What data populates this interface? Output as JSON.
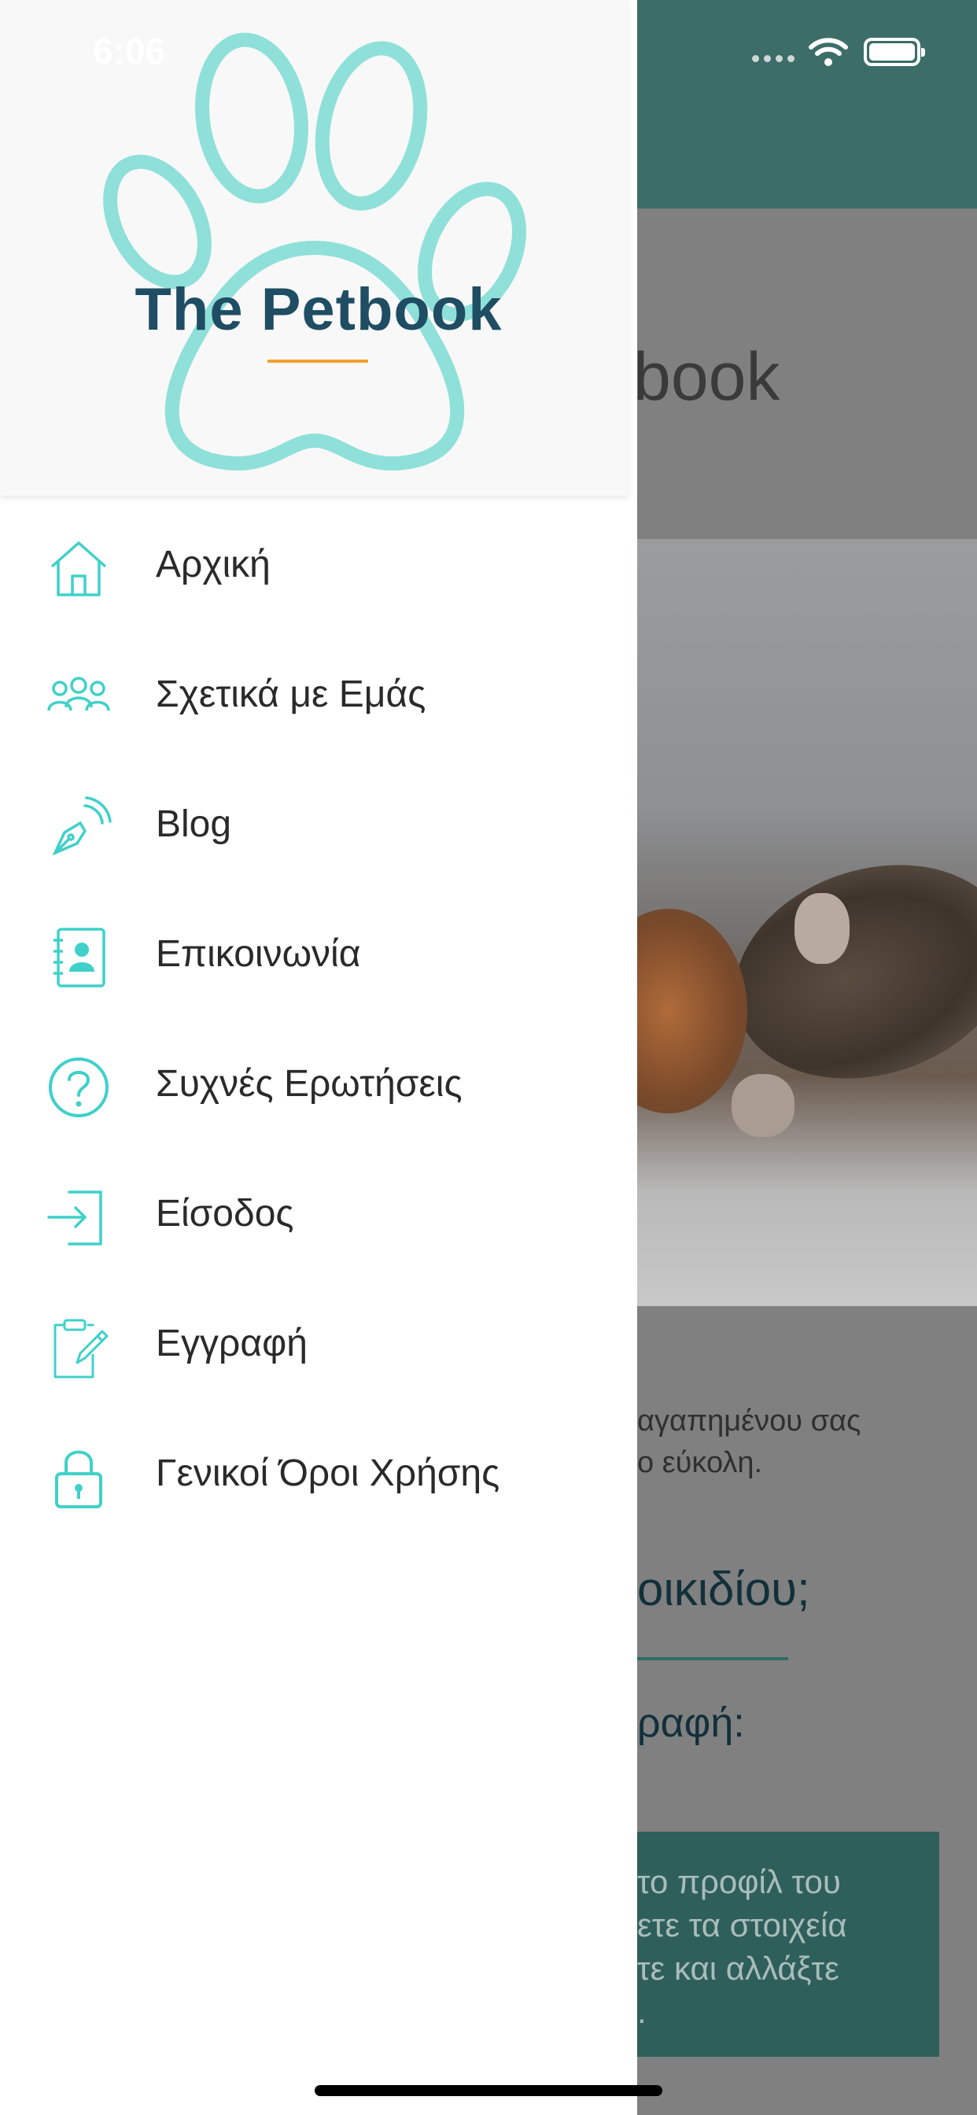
{
  "status_bar": {
    "time": "6:06"
  },
  "brand": {
    "name": "The Petbook"
  },
  "menu": {
    "items": [
      {
        "label": "Αρχική",
        "icon": "home-icon"
      },
      {
        "label": "Σχετικά με Εμάς",
        "icon": "users-icon"
      },
      {
        "label": "Blog",
        "icon": "pen-broadcast-icon"
      },
      {
        "label": "Επικοινωνία",
        "icon": "contact-book-icon"
      },
      {
        "label": "Συχνές Ερωτήσεις",
        "icon": "question-circle-icon"
      },
      {
        "label": "Είσοδος",
        "icon": "login-icon"
      },
      {
        "label": "Εγγραφή",
        "icon": "clipboard-edit-icon"
      },
      {
        "label": "Γενικοί Όροι Χρήσης",
        "icon": "lock-icon"
      }
    ]
  },
  "background_page": {
    "title_fragment": "book",
    "text_line1": "αγαπημένου σας",
    "text_line2": "ο εύκολη.",
    "question_fragment": "οικιδίου;",
    "subheading_fragment": "ραφή:",
    "card_lines": [
      "το προφίλ του",
      "ετε τα στοιχεία",
      "τε και αλλάξτε",
      "."
    ]
  },
  "colors": {
    "accent": "#3fd1c9",
    "topbar": "#3c6d68",
    "brand_text": "#1f4d63",
    "underline": "#f0a030"
  }
}
